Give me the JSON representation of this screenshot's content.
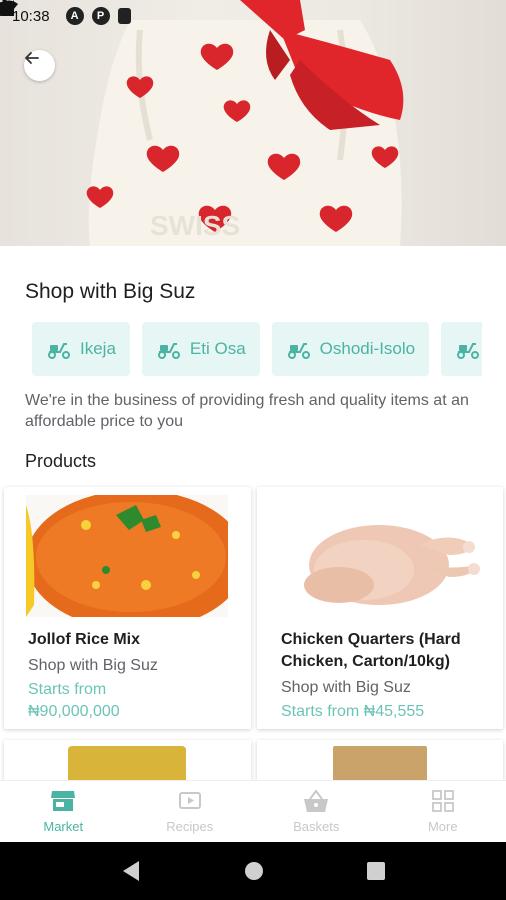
{
  "status_bar": {
    "time": "10:38"
  },
  "hero": {
    "alt": "Gift bag with red hearts and bow"
  },
  "shop": {
    "title": "Shop with Big Suz",
    "locations": [
      "Ikeja",
      "Eti Osa",
      "Oshodi-Isolo"
    ],
    "description": "We're in the business of providing fresh and quality items at an affordable price to you"
  },
  "products_heading": "Products",
  "products": [
    {
      "name": "Jollof Rice Mix",
      "shop": "Shop with Big Suz",
      "starts_from": "Starts from",
      "price": "₦90,000,000"
    },
    {
      "name": "Chicken Quarters (Hard Chicken, Carton/10kg)",
      "shop": "Shop with Big Suz",
      "price_line": "Starts from ₦45,555"
    }
  ],
  "bottom_nav": [
    {
      "label": "Market",
      "icon": "store-icon",
      "active": true
    },
    {
      "label": "Recipes",
      "icon": "video-icon",
      "active": false
    },
    {
      "label": "Baskets",
      "icon": "basket-icon",
      "active": false
    },
    {
      "label": "More",
      "icon": "grid-icon",
      "active": false
    }
  ],
  "colors": {
    "accent": "#4bb3a4",
    "chip_bg": "#e6f6f4",
    "price": "#6cc4b6"
  }
}
